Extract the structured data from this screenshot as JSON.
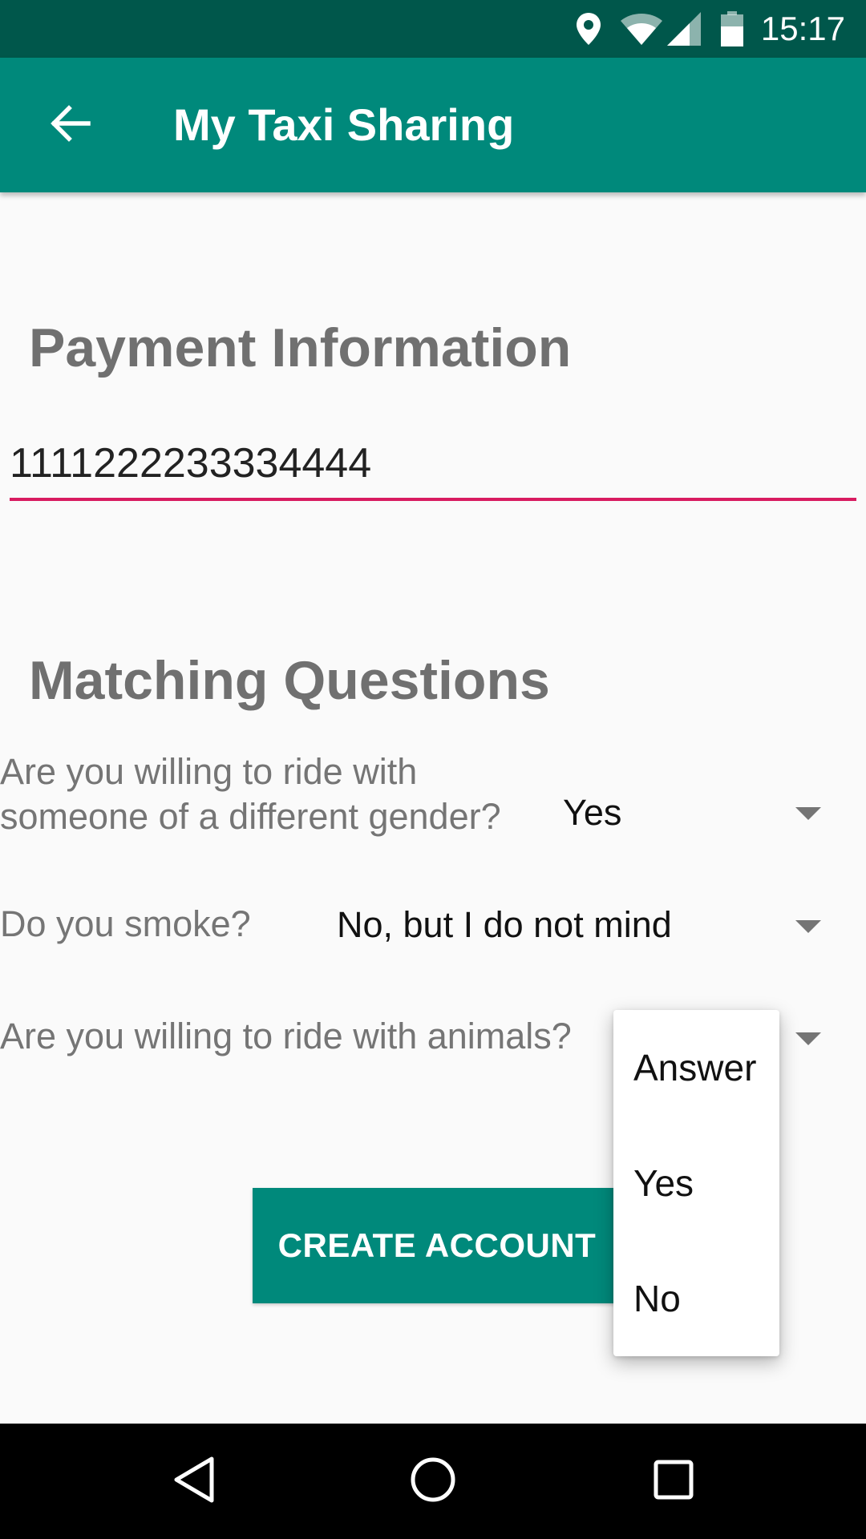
{
  "status_bar": {
    "time": "15:17",
    "icons": [
      "location-icon",
      "wifi-icon",
      "cell-signal-icon",
      "battery-icon"
    ]
  },
  "app_bar": {
    "title": "My Taxi Sharing",
    "back_icon": "arrow-back-icon"
  },
  "payment": {
    "title": "Payment Information",
    "card_number": "1111222233334444"
  },
  "matching": {
    "title": "Matching Questions",
    "questions": [
      {
        "line1": "Are you willing to ride with",
        "line2": "someone of a different gender?",
        "answer": "Yes"
      },
      {
        "line1": "Do you smoke?",
        "answer": "No, but I do not mind"
      },
      {
        "line1": "Are you willing to ride with animals?"
      }
    ]
  },
  "create_button": {
    "label": "CREATE ACCOUNT"
  },
  "dropdown": {
    "options": [
      "Answer",
      "Yes",
      "No"
    ]
  },
  "nav_bar": {
    "icons": [
      "nav-back-icon",
      "nav-home-icon",
      "nav-recents-icon"
    ]
  },
  "colors": {
    "status_bar": "#00574b",
    "primary": "#00897b",
    "accent": "#d81b60"
  }
}
